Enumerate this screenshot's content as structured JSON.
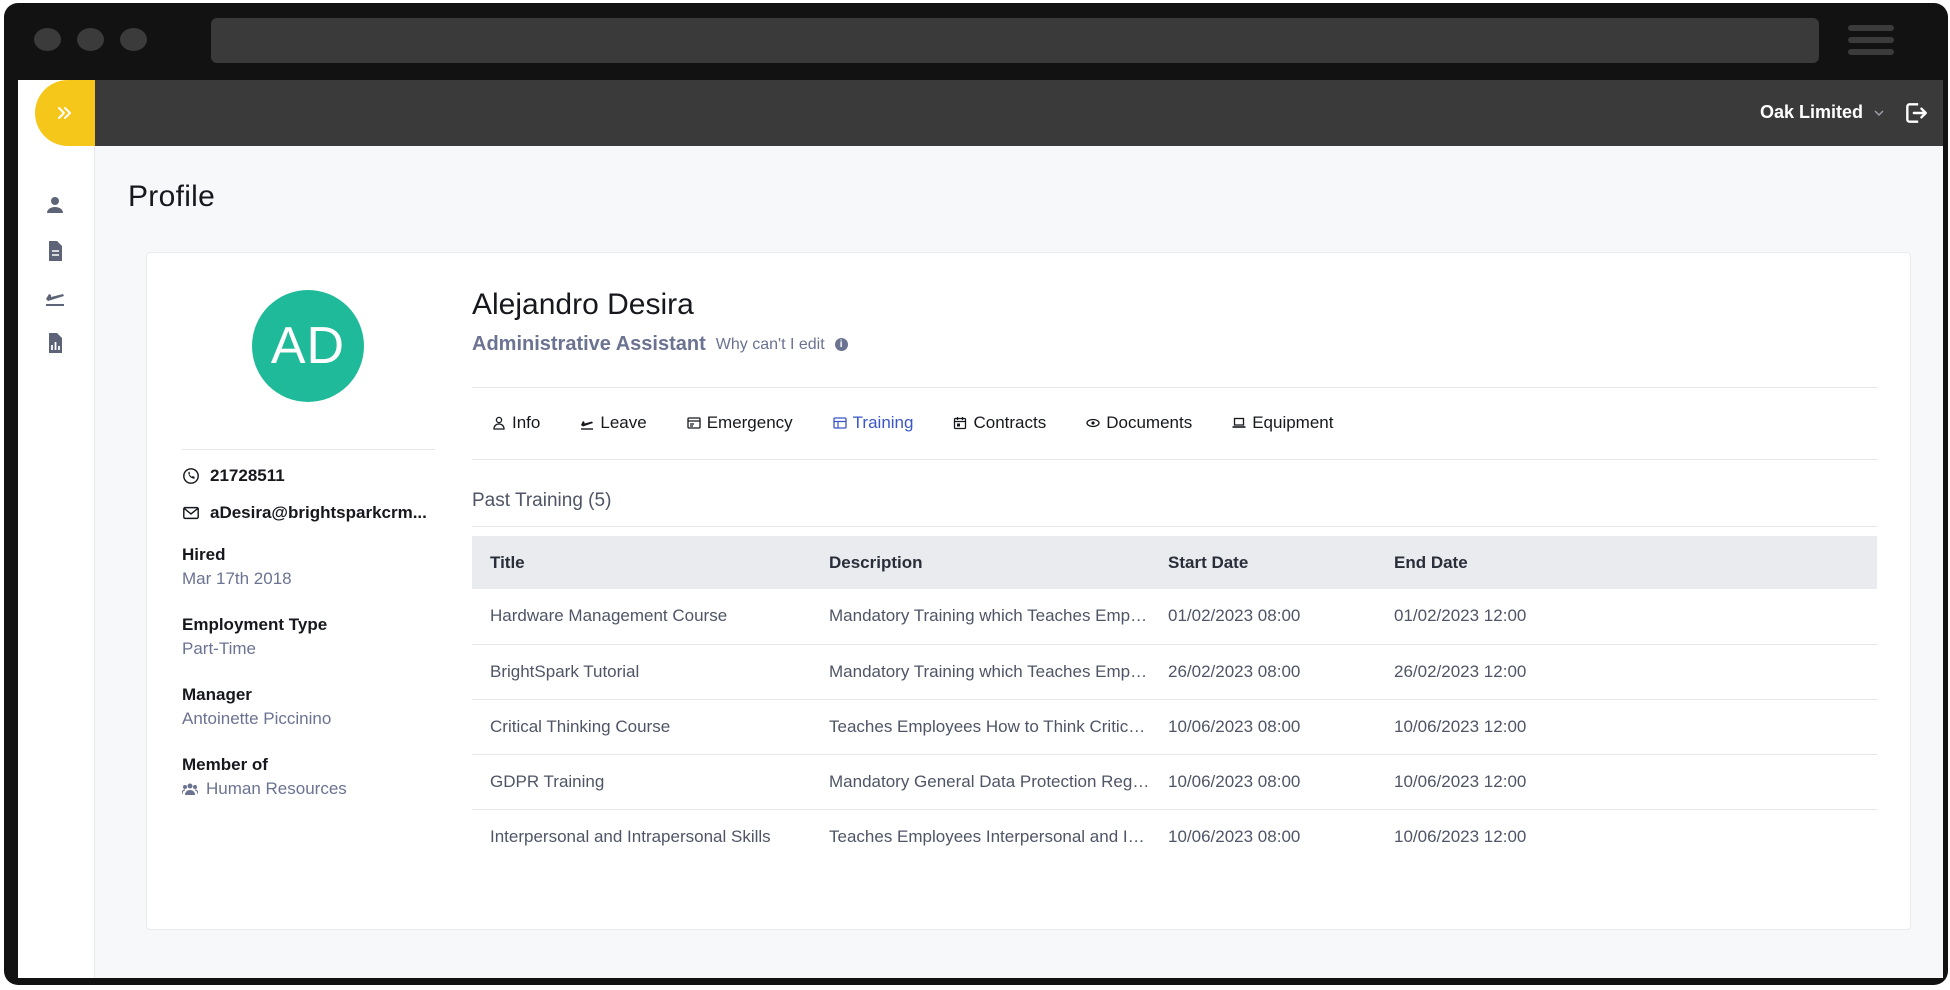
{
  "app": {
    "company": "Oak Limited"
  },
  "page": {
    "title": "Profile"
  },
  "profile": {
    "initials": "AD",
    "avatar_color": "#1fba9a",
    "name": "Alejandro Desira",
    "role": "Administrative Assistant",
    "why_edit": "Why can't I edit",
    "phone": "21728511",
    "email": "aDesira@brightsparkcrm...",
    "hired_label": "Hired",
    "hired_value": "Mar 17th 2018",
    "employment_type_label": "Employment Type",
    "employment_type_value": "Part-Time",
    "manager_label": "Manager",
    "manager_value": "Antoinette Piccinino",
    "member_of_label": "Member of",
    "member_of_value": "Human Resources"
  },
  "tabs": [
    {
      "label": "Info",
      "icon": "person-icon"
    },
    {
      "label": "Leave",
      "icon": "plane-icon"
    },
    {
      "label": "Emergency",
      "icon": "id-card-icon"
    },
    {
      "label": "Training",
      "icon": "table-icon",
      "active": true
    },
    {
      "label": "Contracts",
      "icon": "calendar-icon"
    },
    {
      "label": "Documents",
      "icon": "eye-icon"
    },
    {
      "label": "Equipment",
      "icon": "laptop-icon"
    }
  ],
  "training": {
    "section_title": "Past Training (5)",
    "headers": [
      "Title",
      "Description",
      "Start Date",
      "End Date"
    ],
    "rows": [
      [
        "Hardware Management Course",
        "Mandatory Training which Teaches Employees...",
        "01/02/2023 08:00",
        "01/02/2023 12:00"
      ],
      [
        "BrightSpark Tutorial",
        "Mandatory Training which Teaches Employees...",
        "26/02/2023 08:00",
        "26/02/2023 12:00"
      ],
      [
        "Critical Thinking Course",
        "Teaches Employees How to Think Critically at ...",
        "10/06/2023 08:00",
        "10/06/2023 12:00"
      ],
      [
        "GDPR Training",
        "Mandatory General Data Protection Regulatio...",
        "10/06/2023 08:00",
        "10/06/2023 12:00"
      ],
      [
        "Interpersonal and Intrapersonal Skills",
        "Teaches Employees Interpersonal and Intrape...",
        "10/06/2023 08:00",
        "10/06/2023 12:00"
      ]
    ]
  },
  "colors": {
    "accent": "#3a56c9",
    "sidebar_toggle": "#f6c71b",
    "topbar": "#3a3a3a"
  }
}
